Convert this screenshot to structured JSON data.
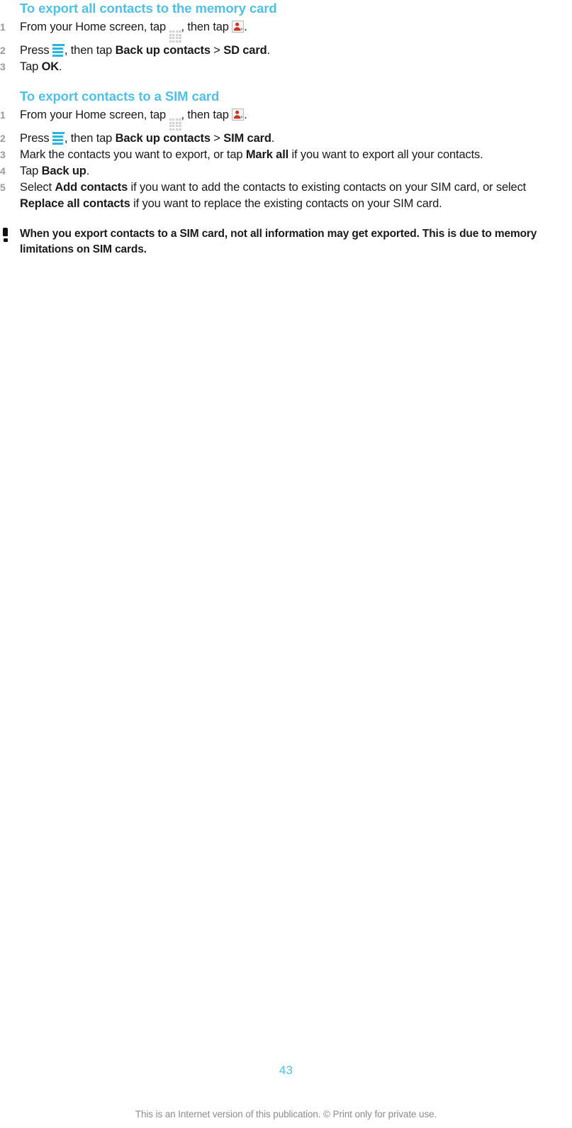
{
  "document": {
    "type": "user-guide-page",
    "page_number": "43",
    "footer_note": "This is an Internet version of this publication. © Print only for private use.",
    "accent_color": "#51c0e7",
    "menu_icon_color": "#2cb3e0",
    "step_number_color": "#9a9a9a",
    "footer_text_color": "#8c8c8c",
    "contacts_icon_color": "#cc3322"
  },
  "sections": [
    {
      "heading": "To export all contacts to the memory card",
      "steps": [
        {
          "number": "1",
          "parts": [
            {
              "type": "text",
              "value": "From your Home screen, tap "
            },
            {
              "type": "icon",
              "name": "app-drawer-grid-icon"
            },
            {
              "type": "text",
              "value": ", then tap "
            },
            {
              "type": "icon",
              "name": "contacts-icon"
            },
            {
              "type": "text",
              "value": "."
            }
          ]
        },
        {
          "number": "2",
          "parts": [
            {
              "type": "text",
              "value": "Press "
            },
            {
              "type": "icon",
              "name": "menu-icon"
            },
            {
              "type": "text",
              "value": ", then tap "
            },
            {
              "type": "bold",
              "value": "Back up contacts"
            },
            {
              "type": "text",
              "value": " > "
            },
            {
              "type": "bold",
              "value": "SD card"
            },
            {
              "type": "text",
              "value": "."
            }
          ]
        },
        {
          "number": "3",
          "parts": [
            {
              "type": "text",
              "value": "Tap "
            },
            {
              "type": "bold",
              "value": "OK"
            },
            {
              "type": "text",
              "value": "."
            }
          ]
        }
      ]
    },
    {
      "heading": "To export contacts to a SIM card",
      "steps": [
        {
          "number": "1",
          "parts": [
            {
              "type": "text",
              "value": "From your Home screen, tap "
            },
            {
              "type": "icon",
              "name": "app-drawer-grid-icon"
            },
            {
              "type": "text",
              "value": ", then tap "
            },
            {
              "type": "icon",
              "name": "contacts-icon"
            },
            {
              "type": "text",
              "value": "."
            }
          ]
        },
        {
          "number": "2",
          "parts": [
            {
              "type": "text",
              "value": "Press "
            },
            {
              "type": "icon",
              "name": "menu-icon"
            },
            {
              "type": "text",
              "value": ", then tap "
            },
            {
              "type": "bold",
              "value": "Back up contacts"
            },
            {
              "type": "text",
              "value": " > "
            },
            {
              "type": "bold",
              "value": "SIM card"
            },
            {
              "type": "text",
              "value": "."
            }
          ]
        },
        {
          "number": "3",
          "parts": [
            {
              "type": "text",
              "value": "Mark the contacts you want to export, or tap "
            },
            {
              "type": "bold",
              "value": "Mark all"
            },
            {
              "type": "text",
              "value": " if you want to export all your contacts."
            }
          ]
        },
        {
          "number": "4",
          "parts": [
            {
              "type": "text",
              "value": "Tap "
            },
            {
              "type": "bold",
              "value": "Back up"
            },
            {
              "type": "text",
              "value": "."
            }
          ]
        },
        {
          "number": "5",
          "parts": [
            {
              "type": "text",
              "value": "Select "
            },
            {
              "type": "bold",
              "value": "Add contacts"
            },
            {
              "type": "text",
              "value": " if you want to add the contacts to existing contacts on your SIM card, or select "
            },
            {
              "type": "bold",
              "value": "Replace all contacts"
            },
            {
              "type": "text",
              "value": " if you want to replace the existing contacts on your SIM card."
            }
          ]
        }
      ]
    }
  ],
  "note": {
    "icon": "exclamation-icon",
    "text": "When you export contacts to a SIM card, not all information may get exported. This is due to memory limitations on SIM cards."
  }
}
